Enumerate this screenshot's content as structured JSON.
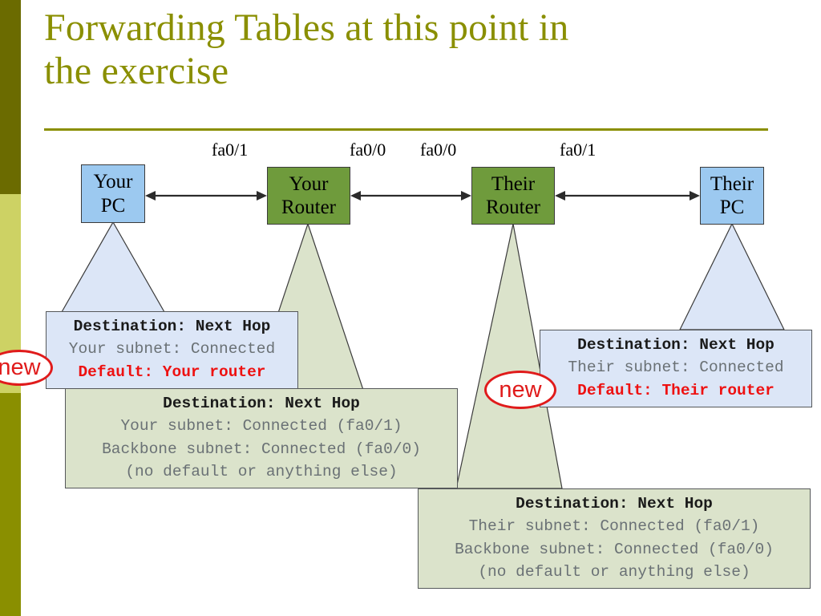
{
  "slide": {
    "title": "Forwarding Tables at this point in\nthe exercise",
    "accent_color": "#8a8f00",
    "sidebar": {
      "band_top_color": "#6b6b00",
      "band_middle_color": "#cdd264",
      "band_bottom_color": "#8a8f00"
    }
  },
  "diagram": {
    "nodes": [
      {
        "id": "your-pc",
        "label": "Your\nPC",
        "kind": "pc",
        "color": "#9cc9f0"
      },
      {
        "id": "your-router",
        "label": "Your\nRouter",
        "kind": "router",
        "color": "#6f9b3c"
      },
      {
        "id": "their-router",
        "label": "Their\nRouter",
        "kind": "router",
        "color": "#6f9b3c"
      },
      {
        "id": "their-pc",
        "label": "Their\nPC",
        "kind": "pc",
        "color": "#9cc9f0"
      }
    ],
    "interface_labels": [
      {
        "id": "your-router-fa01",
        "text": "fa0/1"
      },
      {
        "id": "your-router-fa00",
        "text": "fa0/0"
      },
      {
        "id": "their-router-fa00",
        "text": "fa0/0"
      },
      {
        "id": "their-router-fa01",
        "text": "fa0/1"
      }
    ],
    "links": [
      {
        "from": "your-pc",
        "to": "your-router",
        "style": "double-arrow"
      },
      {
        "from": "your-router",
        "to": "their-router",
        "style": "double-arrow"
      },
      {
        "from": "their-router",
        "to": "their-pc",
        "style": "double-arrow"
      }
    ]
  },
  "callouts": {
    "your_pc": {
      "owner": "Your PC",
      "fill": "#dce6f7",
      "rows": [
        {
          "text": "Destination: Next Hop",
          "style": "head"
        },
        {
          "text": "Your subnet: Connected",
          "style": "muted"
        },
        {
          "text": "Default: Your router",
          "style": "red"
        }
      ]
    },
    "your_router": {
      "owner": "Your Router",
      "fill": "#dbe3cb",
      "rows": [
        {
          "text": "Destination: Next Hop",
          "style": "head"
        },
        {
          "text": "Your subnet: Connected (fa0/1)",
          "style": "muted"
        },
        {
          "text": "Backbone subnet: Connected (fa0/0)",
          "style": "muted"
        },
        {
          "text": "(no default or anything else)",
          "style": "muted"
        }
      ]
    },
    "their_pc": {
      "owner": "Their PC",
      "fill": "#dce6f7",
      "rows": [
        {
          "text": "Destination: Next Hop",
          "style": "head"
        },
        {
          "text": "Their subnet: Connected",
          "style": "muted"
        },
        {
          "text": "Default: Their router",
          "style": "red"
        }
      ]
    },
    "their_router": {
      "owner": "Their Router",
      "fill": "#dbe3cb",
      "rows": [
        {
          "text": "Destination: Next Hop",
          "style": "head"
        },
        {
          "text": "Their subnet: Connected (fa0/1)",
          "style": "muted"
        },
        {
          "text": "Backbone subnet: Connected (fa0/0)",
          "style": "muted"
        },
        {
          "text": "(no default or anything else)",
          "style": "muted"
        }
      ]
    }
  },
  "annotations": {
    "new_left": {
      "label": "new",
      "color": "#e01b1b"
    },
    "new_right": {
      "label": "new",
      "color": "#e01b1b"
    }
  }
}
